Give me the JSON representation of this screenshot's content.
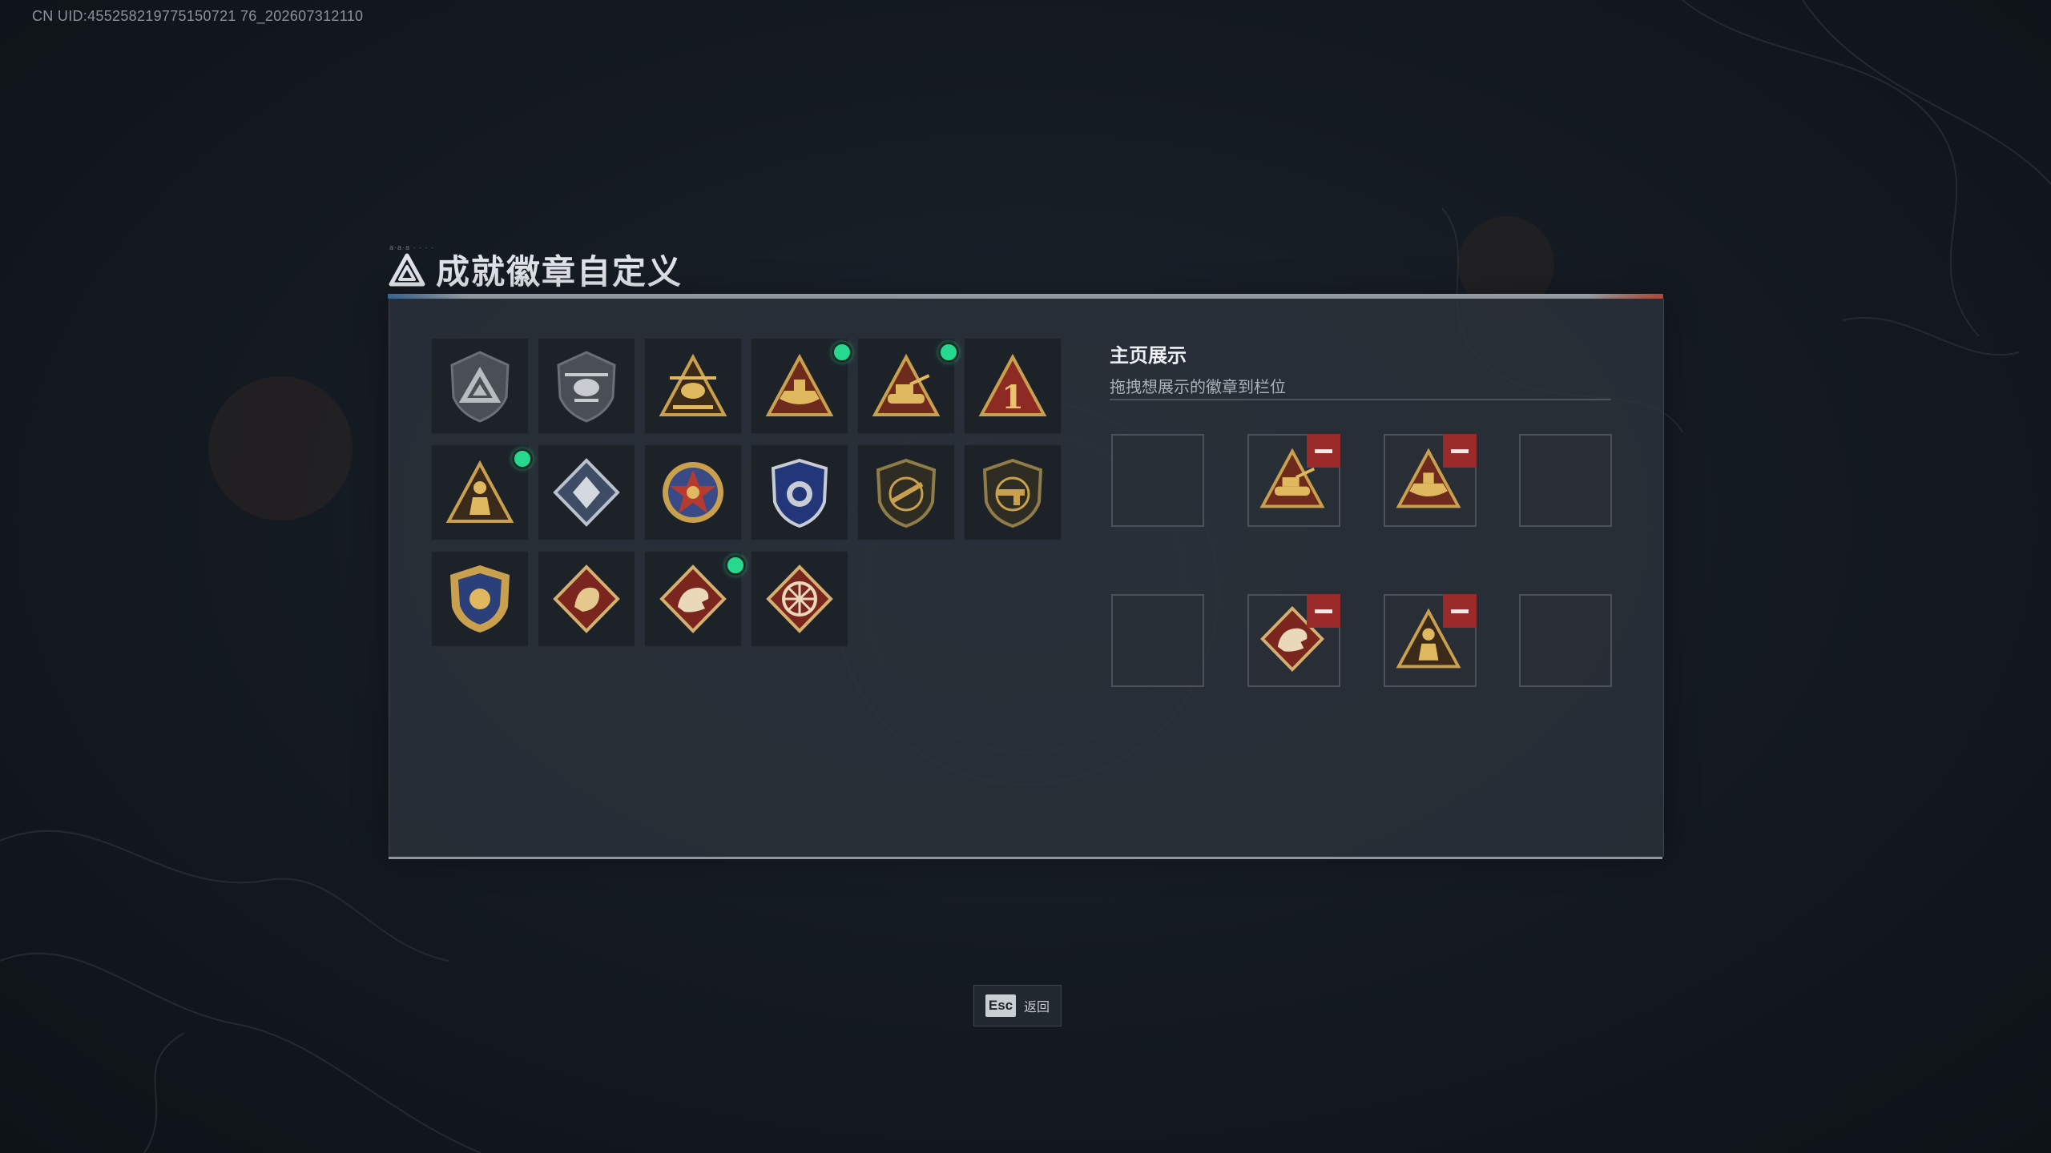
{
  "uid_text": "CN UID:455258219775150721 76_202607312110",
  "title": "成就徽章自定义",
  "title_deco": "a·a·a  ·  ·  ·  ·",
  "badges": [
    {
      "icon": "gray-triangle-shield-badge-icon",
      "new": false
    },
    {
      "icon": "gray-helicopter-shield-badge-icon",
      "new": false
    },
    {
      "icon": "gold-helicopter-triangle-badge-icon",
      "new": false
    },
    {
      "icon": "gold-boat-triangle-badge-icon",
      "new": true
    },
    {
      "icon": "gold-tank-triangle-badge-icon",
      "new": true
    },
    {
      "icon": "red-number-one-triangle-badge-icon",
      "new": false
    },
    {
      "icon": "gold-soldier-triangle-badge-icon",
      "new": true
    },
    {
      "icon": "silver-diamond-badge-icon",
      "new": false
    },
    {
      "icon": "red-gold-star-medal-icon",
      "new": false
    },
    {
      "icon": "blue-police-shield-badge-icon",
      "new": false
    },
    {
      "icon": "dark-rifle-shield-badge-icon",
      "new": false
    },
    {
      "icon": "dark-pistol-shield-badge-icon",
      "new": false
    },
    {
      "icon": "gold-blue-crest-badge-icon",
      "new": false
    },
    {
      "icon": "red-dragon-diamond-badge-icon",
      "new": false
    },
    {
      "icon": "red-dinosaur-diamond-badge-icon",
      "new": true
    },
    {
      "icon": "red-wheel-diamond-badge-icon",
      "new": false
    }
  ],
  "showcase": {
    "title": "主页展示",
    "subtitle": "拖拽想展示的徽章到栏位",
    "slots": [
      {
        "filled": false
      },
      {
        "filled": true,
        "icon": "gold-tank-triangle-badge-icon"
      },
      {
        "filled": true,
        "icon": "gold-boat-triangle-badge-icon"
      },
      {
        "filled": false
      },
      {
        "filled": false
      },
      {
        "filled": true,
        "icon": "red-dinosaur-diamond-badge-icon"
      },
      {
        "filled": true,
        "icon": "gold-soldier-triangle-badge-icon"
      },
      {
        "filled": false
      }
    ]
  },
  "footer": {
    "esc_key": "Esc",
    "esc_label": "返回"
  },
  "colors": {
    "accent_new": "#27d98f",
    "remove": "#9b2b2b",
    "gold": "#c9a04e",
    "red_badge": "#8e2a24"
  }
}
